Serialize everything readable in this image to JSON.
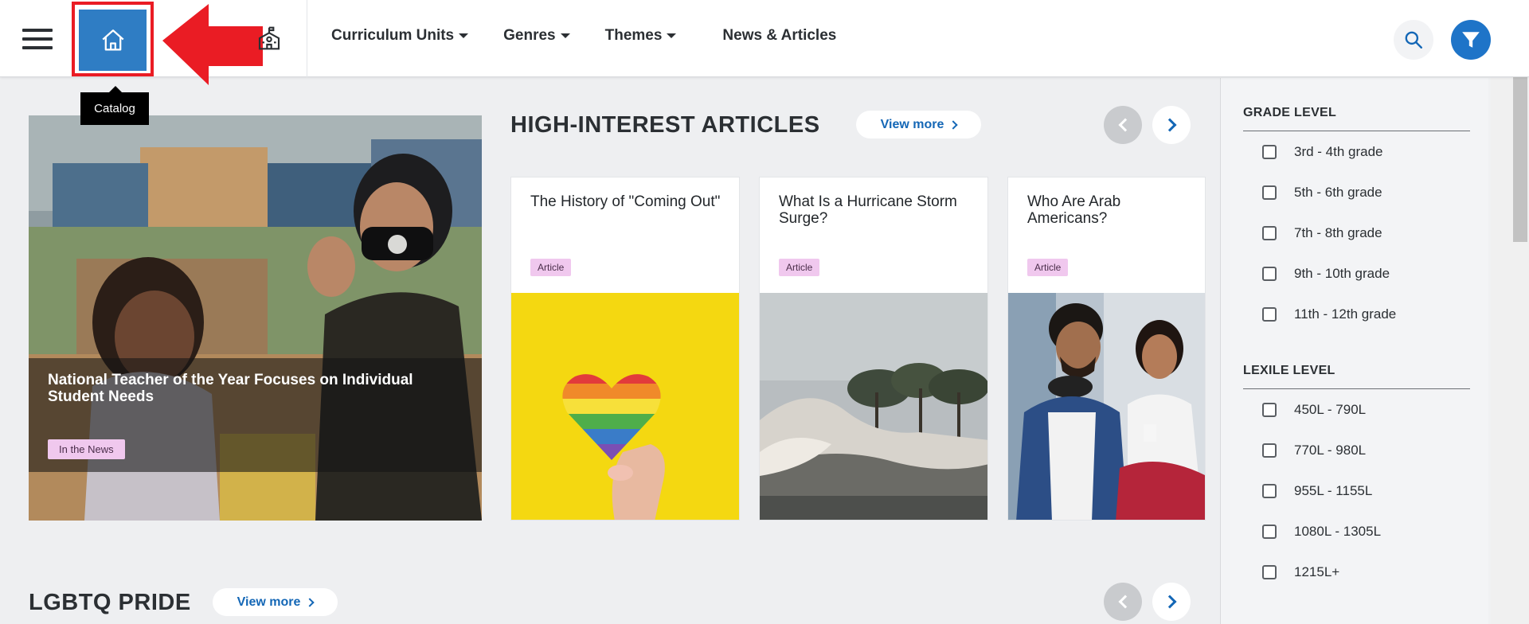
{
  "header": {
    "nav": [
      {
        "label": "Curriculum Units",
        "dropdown": true
      },
      {
        "label": "Genres",
        "dropdown": true
      },
      {
        "label": "Themes",
        "dropdown": true
      },
      {
        "label": "News & Articles",
        "dropdown": false
      }
    ],
    "home_tooltip": "Catalog",
    "icons": {
      "menu": "hamburger-menu-icon",
      "home": "home-icon",
      "school": "school-icon",
      "search": "search-icon",
      "filter": "filter-icon"
    },
    "colors": {
      "home_bg": "#2f7dc4",
      "highlight": "#ea1c24",
      "filter_bg": "#1e74c8",
      "link": "#1467b6"
    }
  },
  "feature": {
    "title": "National Teacher of the Year Focuses on Individual Student Needs",
    "tag": "In the News"
  },
  "high_interest": {
    "title": "HIGH-INTEREST ARTICLES",
    "view_more": "View more",
    "cards": [
      {
        "title": "The History of \"Coming Out\"",
        "tag": "Article"
      },
      {
        "title": "What Is a Hurricane Storm Surge?",
        "tag": "Article"
      },
      {
        "title": "Who Are Arab Americans?",
        "tag": "Article"
      }
    ]
  },
  "lgbtq": {
    "title": "LGBTQ PRIDE",
    "view_more": "View more"
  },
  "filters": {
    "grade_level": {
      "heading": "GRADE LEVEL",
      "options": [
        "3rd - 4th grade",
        "5th - 6th grade",
        "7th - 8th grade",
        "9th - 10th grade",
        "11th - 12th grade"
      ]
    },
    "lexile_level": {
      "heading": "LEXILE LEVEL",
      "options": [
        "450L - 790L",
        "770L - 980L",
        "955L - 1155L",
        "1080L - 1305L",
        "1215L+"
      ]
    }
  }
}
